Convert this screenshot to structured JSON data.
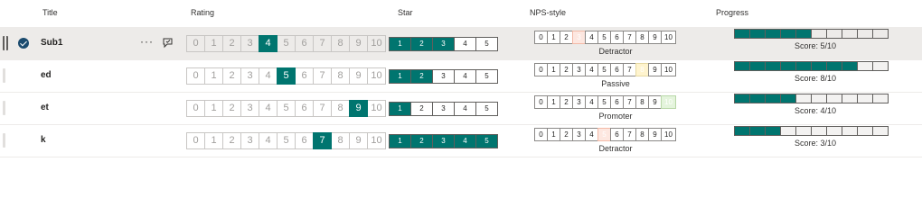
{
  "columns": {
    "title": "Title",
    "rating": "Rating",
    "star": "Star",
    "nps": "NPS-style",
    "progress": "Progress"
  },
  "rating_scale": [
    "0",
    "1",
    "2",
    "3",
    "4",
    "5",
    "6",
    "7",
    "8",
    "9",
    "10"
  ],
  "star_scale": [
    "1",
    "2",
    "3",
    "4",
    "5"
  ],
  "nps_scale": [
    "0",
    "1",
    "2",
    "3",
    "4",
    "5",
    "6",
    "7",
    "8",
    "9",
    "10"
  ],
  "progress_segments": 10,
  "colors": {
    "accent": "#00756f",
    "detractor": "#fde7e0",
    "passive": "#fff4ce",
    "promoter": "#e4f4dc"
  },
  "rows": [
    {
      "title": "Sub1",
      "selected": true,
      "more_label": "···",
      "rating": 4,
      "star": 3,
      "nps": 3,
      "nps_category": "detractor",
      "nps_label": "Detractor",
      "progress": 5,
      "progress_label": "Score: 5/10"
    },
    {
      "title": "ed",
      "selected": false,
      "rating": 5,
      "star": 2,
      "nps": 8,
      "nps_category": "passive",
      "nps_label": "Passive",
      "progress": 8,
      "progress_label": "Score: 8/10"
    },
    {
      "title": "et",
      "selected": false,
      "rating": 9,
      "star": 1,
      "nps": 10,
      "nps_category": "promoter",
      "nps_label": "Promoter",
      "progress": 4,
      "progress_label": "Score: 4/10"
    },
    {
      "title": "k",
      "selected": false,
      "rating": 7,
      "star": 5,
      "nps": 5,
      "nps_category": "detractor",
      "nps_label": "Detractor",
      "progress": 3,
      "progress_label": "Score: 3/10"
    }
  ]
}
